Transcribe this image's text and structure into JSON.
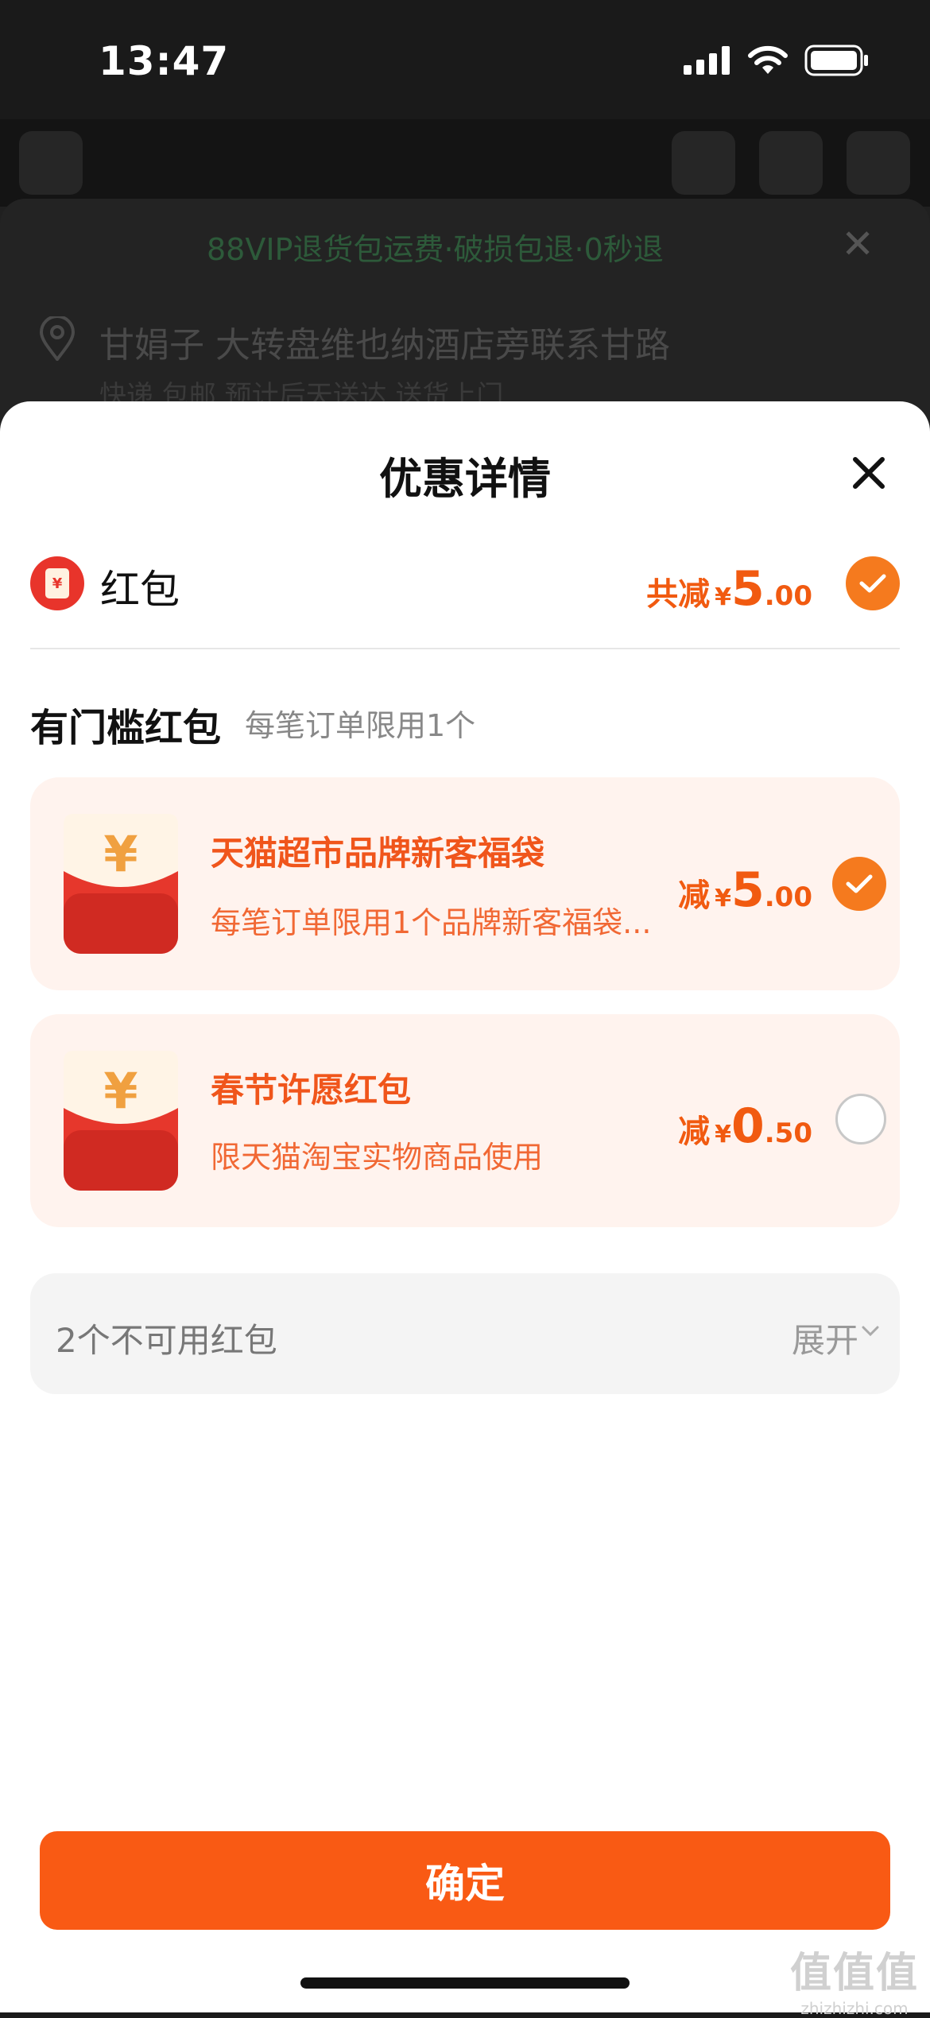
{
  "status_bar": {
    "time": "13:47"
  },
  "background": {
    "banner": "88VIP退货包运费·破损包退·0秒退",
    "address": "甘娟子 大转盘维也纳酒店旁联系甘路",
    "delivery": "快递 包邮 预计后天送达 送货上门"
  },
  "sheet": {
    "title": "优惠详情",
    "red_packet": {
      "label": "红包",
      "total_prefix": "共减",
      "currency": "¥",
      "total_int": "5",
      "total_dec": ".00",
      "selected": true
    },
    "section": {
      "title": "有门槛红包",
      "subtitle": "每笔订单限用1个"
    },
    "coupons": [
      {
        "title": "天猫超市品牌新客福袋",
        "desc": "每笔订单限用1个品牌新客福袋...",
        "prefix": "减",
        "currency": "¥",
        "amount_int": "5",
        "amount_dec": ".00",
        "selected": true
      },
      {
        "title": "春节许愿红包",
        "desc": "限天猫淘宝实物商品使用",
        "prefix": "减",
        "currency": "¥",
        "amount_int": "0",
        "amount_dec": ".50",
        "selected": false
      }
    ],
    "unavailable": {
      "label": "2个不可用红包",
      "expand": "展开"
    },
    "confirm_label": "确定"
  },
  "watermark": {
    "line1": "值值值",
    "line2": "zhizhizhi.com"
  },
  "colors": {
    "accent": "#f95a14",
    "price": "#f15a10",
    "card_bg": "#fff3ee",
    "red": "#e8342b"
  }
}
